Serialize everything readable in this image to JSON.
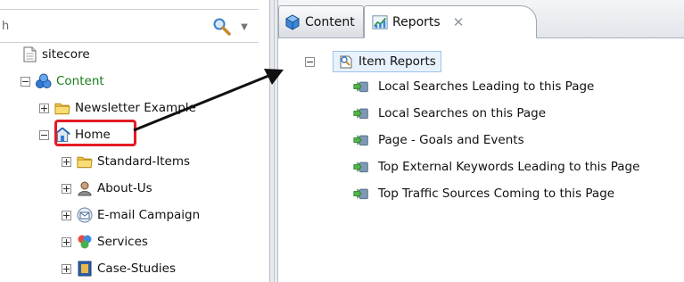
{
  "search": {
    "value": "h",
    "placeholder": ""
  },
  "tree": {
    "sitecore": "sitecore",
    "content": "Content",
    "newsletter": "Newsletter Example",
    "home": "Home",
    "children": [
      "Standard-Items",
      "About-Us",
      "E-mail Campaign",
      "Services",
      "Case-Studies"
    ]
  },
  "tabs": {
    "content": "Content",
    "reports": "Reports",
    "close": "✕"
  },
  "reports": {
    "root": "Item Reports",
    "items": [
      "Local Searches Leading to this Page",
      "Local Searches on this Page",
      "Page - Goals and Events",
      "Top External Keywords Leading to this Page",
      "Top Traffic Sources Coming to this Page"
    ]
  },
  "colors": {
    "highlight": "#e31b23",
    "content_label": "#1a7d1a",
    "selection": "#e8f2fd"
  },
  "icons": [
    "document-icon",
    "content-icon",
    "folder-icon",
    "home-icon",
    "person-icon",
    "email-campaign-icon",
    "services-icon",
    "case-studies-icon",
    "cube-icon",
    "reports-chart-icon",
    "item-reports-icon",
    "report-play-icon",
    "search-icon"
  ]
}
